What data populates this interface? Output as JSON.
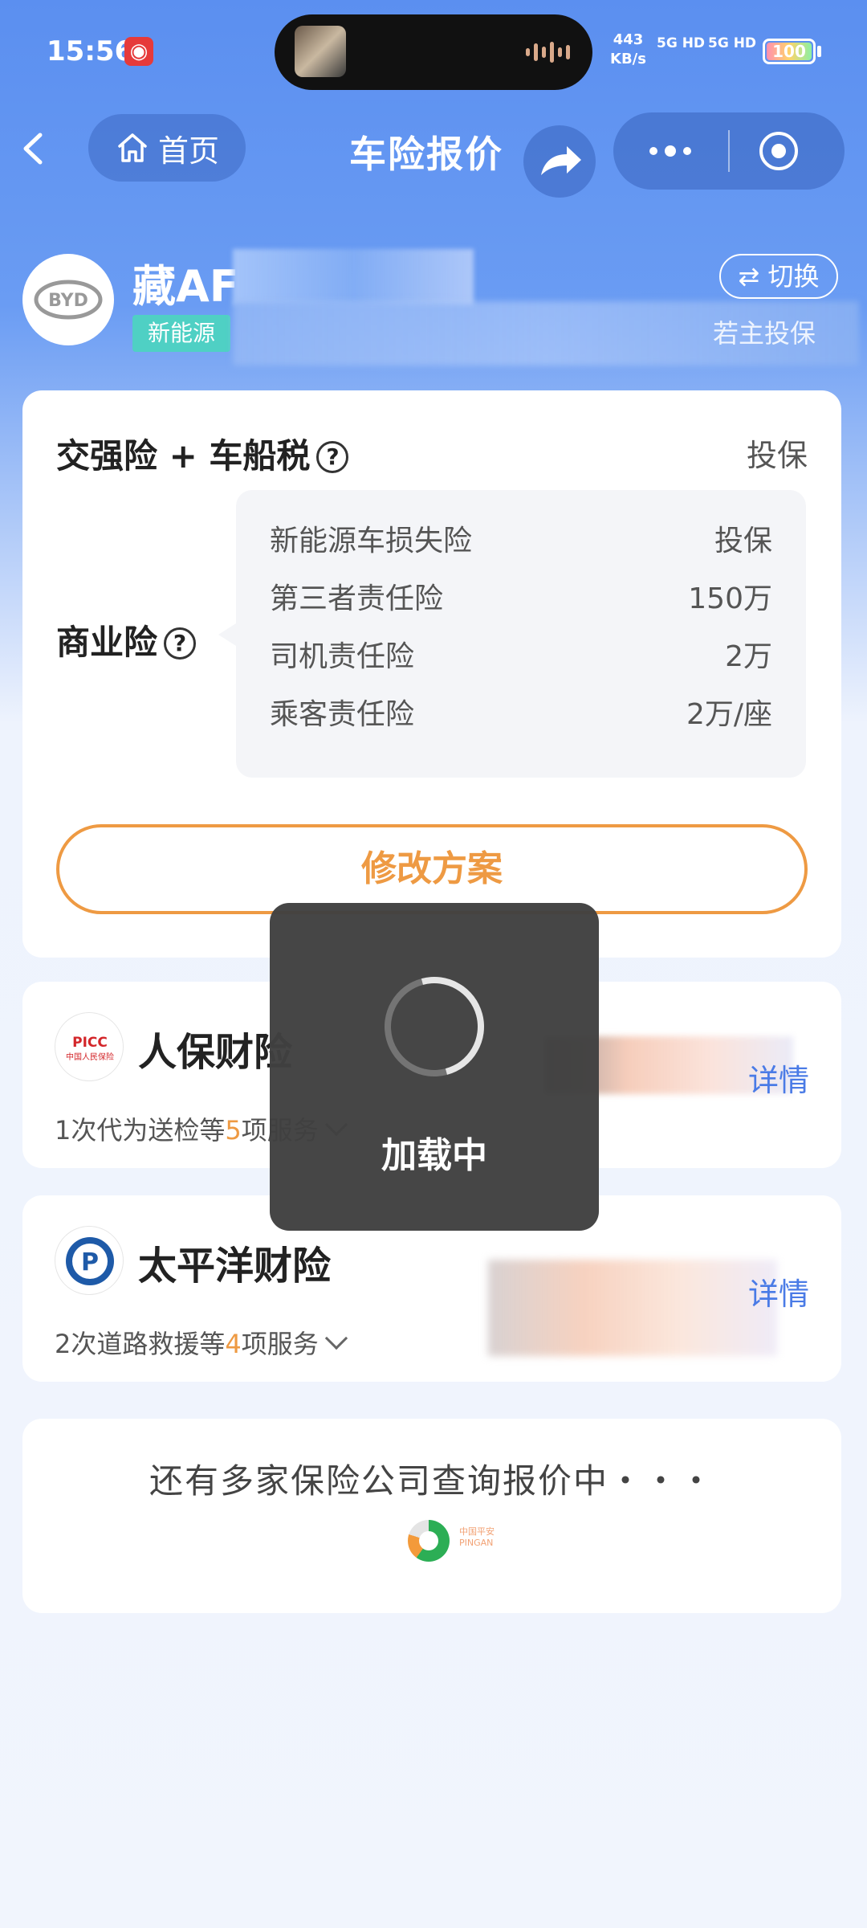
{
  "status_bar": {
    "time": "15:56",
    "net_speed_value": "443",
    "net_speed_unit": "KB/s",
    "signal_1": "5G HD",
    "signal_2": "5G HD",
    "battery": "100"
  },
  "nav": {
    "home_label": "首页",
    "title": "车险报价"
  },
  "vehicle": {
    "plate_visible": "藏AF",
    "tag": "新能源",
    "switch_label": "⇄ 切换",
    "owner_link_partial": "若主投保"
  },
  "plan": {
    "compulsory_label": "交强险 + 车船税",
    "compulsory_action": "投保",
    "commercial_label": "商业险",
    "items": [
      {
        "name": "新能源车损失险",
        "value": "投保"
      },
      {
        "name": "第三者责任险",
        "value": "150万"
      },
      {
        "name": "司机责任险",
        "value": "2万"
      },
      {
        "name": "乘客责任险",
        "value": "2万/座"
      }
    ],
    "modify_button": "修改方案"
  },
  "insurers": [
    {
      "name": "人保财险",
      "logo_text": "PICC",
      "logo_sub": "中国人民保险",
      "services_prefix": "1次代为送检等",
      "services_num": "5",
      "services_suffix": "项服务",
      "detail": "详情"
    },
    {
      "name": "太平洋财险",
      "logo_text": "P",
      "services_prefix": "2次道路救援等",
      "services_num": "4",
      "services_suffix": "项服务",
      "detail": "详情"
    }
  ],
  "more": {
    "text": "还有多家保险公司查询报价中・・・",
    "logo_cn": "中国平安",
    "logo_en": "PINGAN"
  },
  "loading": {
    "text": "加载中"
  },
  "colors": {
    "accent_orange": "#ee9a43",
    "brand_blue": "#5b8ff0",
    "link_blue": "#4a7be6",
    "nev_tag": "#4fd0c4"
  }
}
